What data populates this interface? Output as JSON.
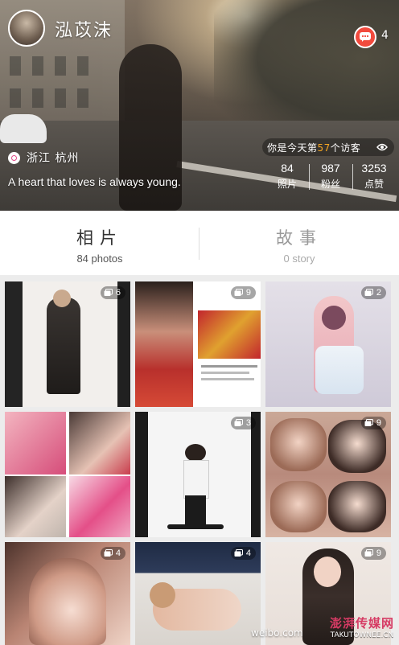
{
  "profile": {
    "username": "泓苡沫",
    "location": "浙江 杭州",
    "bio": "A heart that loves is always young.",
    "message_count": "4",
    "visitor": {
      "prefix": "你是今天第",
      "number": "57",
      "suffix": "个访客"
    },
    "stats": [
      {
        "value": "84",
        "label": "照片"
      },
      {
        "value": "987",
        "label": "粉丝"
      },
      {
        "value": "3253",
        "label": "点赞"
      }
    ]
  },
  "tabs": [
    {
      "title": "相片",
      "subtitle": "84 photos",
      "active": true
    },
    {
      "title": "故事",
      "subtitle": "0 story",
      "active": false
    }
  ],
  "albums": [
    {
      "count": "6"
    },
    {
      "count": "9"
    },
    {
      "count": "2"
    },
    {
      "count": ""
    },
    {
      "count": "3"
    },
    {
      "count": "9"
    },
    {
      "count": "4"
    },
    {
      "count": "4"
    },
    {
      "count": "9"
    }
  ],
  "watermark": {
    "weibo": "weibo.com",
    "site_name": "澎湃传媒网",
    "site_url": "TAKUTOWNEE.CN"
  },
  "colors": {
    "accent_red": "#f24a3d",
    "visitor_number": "#f5a623",
    "location_pink": "#e04a86"
  }
}
